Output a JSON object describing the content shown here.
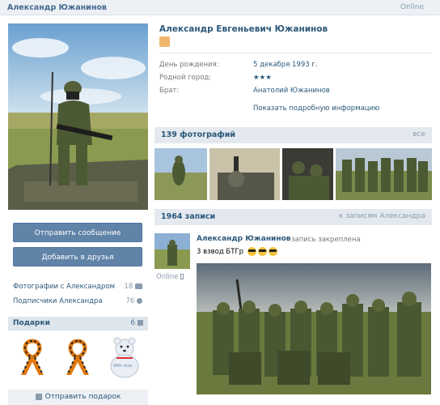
{
  "header": {
    "name": "Александр Южанинов",
    "status": "Online"
  },
  "sidebar": {
    "send_message": "Отправить сообщение",
    "add_friend": "Добавить в друзья",
    "links": [
      {
        "label": "Фотографии с Александром",
        "count": "18"
      },
      {
        "label": "Подписчики Александра",
        "count": "76"
      }
    ],
    "gifts": {
      "title": "Подарки",
      "count": "6",
      "send_gift": "Отправить подарок",
      "gift3_text": "With love"
    }
  },
  "profile": {
    "full_name": "Александр Евгеньевич Южанинов",
    "info": [
      {
        "label": "День рождения:",
        "value": "5 декабря 1993 г."
      },
      {
        "label": "Родной город:",
        "value": "★★★"
      },
      {
        "label": "Брат:",
        "value": "Анатолий Южанинов"
      }
    ],
    "show_more": "Показать подробную информацию"
  },
  "photos": {
    "title": "139 фотографий",
    "all": "все"
  },
  "wall": {
    "title": "1964 записи",
    "to_posts": "к записям Александра",
    "post": {
      "author": "Александр Южанинов",
      "pinned": "запись закреплена",
      "text": "3 взвод БТГр",
      "online": "Online"
    }
  },
  "colors": {
    "link": "#2b587a",
    "button": "#6083a8",
    "header_bg": "#e4e9ef"
  }
}
